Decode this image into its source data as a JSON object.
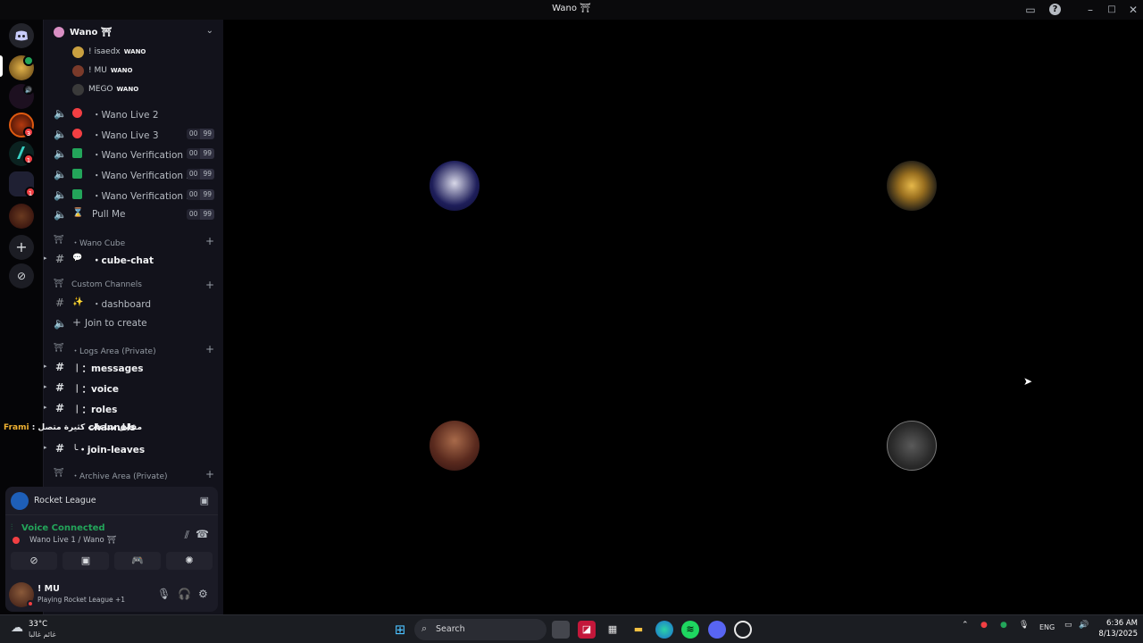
{
  "window": {
    "title": "Wano ⛩",
    "help_icon": "help-icon",
    "inbox_icon": "inbox-icon"
  },
  "server_rail": {
    "items": [
      {
        "name": "discord-home-icon"
      },
      {
        "name": "server-wano",
        "badge": ""
      },
      {
        "name": "server-pxcb"
      },
      {
        "name": "server-mt",
        "badge": "3"
      },
      {
        "name": "server-d",
        "badge": "1"
      },
      {
        "name": "server-folder",
        "badge": "1"
      },
      {
        "name": "server-rank"
      },
      {
        "name": "add-server-icon"
      },
      {
        "name": "discover-icon"
      }
    ]
  },
  "guild": {
    "name": "Wano ⛩"
  },
  "members": [
    {
      "name": "! isaedx",
      "tag": "WANO"
    },
    {
      "name": "! MU",
      "tag": "WANO"
    },
    {
      "name": "MEGO",
      "tag": "WANO"
    }
  ],
  "voice_channels": [
    {
      "name": "・Wano Live 2",
      "status": "#f23f43",
      "cap": null
    },
    {
      "name": "・Wano Live 3",
      "status": "#f23f43",
      "cap": [
        "00",
        "99"
      ]
    },
    {
      "name": "・Wano Verification 1",
      "status": "#23a55a",
      "cap": [
        "00",
        "99"
      ]
    },
    {
      "name": "・Wano Verification 2",
      "status": "#23a55a",
      "cap": [
        "00",
        "99"
      ]
    },
    {
      "name": "・Wano Verification 3",
      "status": "#23a55a",
      "cap": [
        "00",
        "99"
      ]
    },
    {
      "name": "Pull Me",
      "status": "hourglass",
      "cap": [
        "00",
        "99"
      ]
    }
  ],
  "categories": {
    "cube": {
      "label": "・Wano Cube"
    },
    "custom": {
      "label": "Custom Channels"
    },
    "logs": {
      "label": "・Logs Area (Private)"
    },
    "archive": {
      "label": "・Archive Area (Private)"
    }
  },
  "channels": {
    "cube_chat": "・cube-chat",
    "dashboard": "・dashboard",
    "join_to_create": "Join to create",
    "messages": "︱：messages",
    "voice": "︱：voice",
    "roles": "︱：roles",
    "channels": "channels",
    "join_leaves": "╰・join-leaves"
  },
  "overlay": {
    "prefix": "Frami",
    "text": ": مقابل ساعات كثيرة متصل"
  },
  "activity": {
    "name": "Rocket League"
  },
  "voice_status": {
    "title": "Voice Connected",
    "location": "Wano Live 1 / Wano ⛩"
  },
  "user": {
    "name": "! MU",
    "status": "Playing Rocket League +1"
  },
  "tiles": [
    {
      "bg": "#141046"
    },
    {
      "bg": "#151515"
    },
    {
      "bg": "#3a1616"
    },
    {
      "bg": "#151515"
    }
  ],
  "taskbar": {
    "weather_temp": "33°C",
    "weather_desc": "غائم غالبا",
    "search": "Search",
    "lang": "ENG",
    "time": "6:36 AM",
    "date": "8/13/2025"
  }
}
